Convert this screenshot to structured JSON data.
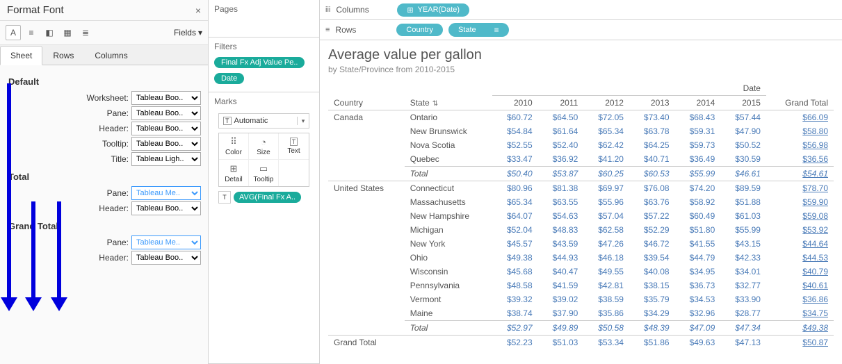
{
  "format_panel": {
    "title": "Format Font",
    "fields_label": "Fields",
    "tabs": [
      "Sheet",
      "Rows",
      "Columns"
    ],
    "sections": {
      "default": {
        "title": "Default",
        "rows": [
          {
            "label": "Worksheet:",
            "value": "Tableau Boo..",
            "blue": false
          },
          {
            "label": "Pane:",
            "value": "Tableau Boo..",
            "blue": false
          },
          {
            "label": "Header:",
            "value": "Tableau Boo..",
            "blue": false
          },
          {
            "label": "Tooltip:",
            "value": "Tableau Boo..",
            "blue": false
          },
          {
            "label": "Title:",
            "value": "Tableau Ligh..",
            "blue": false
          }
        ]
      },
      "total": {
        "title": "Total",
        "rows": [
          {
            "label": "Pane:",
            "value": "Tableau Me..",
            "blue": true
          },
          {
            "label": "Header:",
            "value": "Tableau Boo..",
            "blue": false
          }
        ]
      },
      "grand_total": {
        "title": "Grand Total",
        "rows": [
          {
            "label": "Pane:",
            "value": "Tableau Me..",
            "blue": true
          },
          {
            "label": "Header:",
            "value": "Tableau Boo..",
            "blue": false
          }
        ]
      }
    }
  },
  "shelves": {
    "pages": "Pages",
    "filters": "Filters",
    "filter_pills": [
      "Final Fx Adj Value Pe..",
      "Date"
    ],
    "marks": "Marks",
    "marks_type": "Automatic",
    "mark_cells": [
      "Color",
      "Size",
      "Text",
      "Detail",
      "Tooltip"
    ],
    "mark_pill": "AVG(Final Fx A..",
    "columns_label": "Columns",
    "columns_pill": "YEAR(Date)",
    "rows_label": "Rows",
    "rows_pills": [
      "Country",
      "State"
    ]
  },
  "viz": {
    "title": "Average value per gallon",
    "subtitle": "by State/Province from 2010-2015",
    "date_label": "Date",
    "col_country": "Country",
    "col_state": "State",
    "years": [
      "2010",
      "2011",
      "2012",
      "2013",
      "2014",
      "2015"
    ],
    "grand_total_label": "Grand Total",
    "total_label": "Total",
    "groups": [
      {
        "country": "Canada",
        "rows": [
          {
            "state": "Ontario",
            "v": [
              "$60.72",
              "$64.50",
              "$72.05",
              "$73.40",
              "$68.43",
              "$57.44"
            ],
            "gt": "$66.09"
          },
          {
            "state": "New Brunswick",
            "v": [
              "$54.84",
              "$61.64",
              "$65.34",
              "$63.78",
              "$59.31",
              "$47.90"
            ],
            "gt": "$58.80"
          },
          {
            "state": "Nova Scotia",
            "v": [
              "$52.55",
              "$52.40",
              "$62.42",
              "$64.25",
              "$59.73",
              "$50.52"
            ],
            "gt": "$56.98"
          },
          {
            "state": "Quebec",
            "v": [
              "$33.47",
              "$36.92",
              "$41.20",
              "$40.71",
              "$36.49",
              "$30.59"
            ],
            "gt": "$36.56"
          }
        ],
        "total": {
          "v": [
            "$50.40",
            "$53.87",
            "$60.25",
            "$60.53",
            "$55.99",
            "$46.61"
          ],
          "gt": "$54.61"
        }
      },
      {
        "country": "United States",
        "rows": [
          {
            "state": "Connecticut",
            "v": [
              "$80.96",
              "$81.38",
              "$69.97",
              "$76.08",
              "$74.20",
              "$89.59"
            ],
            "gt": "$78.70"
          },
          {
            "state": "Massachusetts",
            "v": [
              "$65.34",
              "$63.55",
              "$55.96",
              "$63.76",
              "$58.92",
              "$51.88"
            ],
            "gt": "$59.90"
          },
          {
            "state": "New Hampshire",
            "v": [
              "$64.07",
              "$54.63",
              "$57.04",
              "$57.22",
              "$60.49",
              "$61.03"
            ],
            "gt": "$59.08"
          },
          {
            "state": "Michigan",
            "v": [
              "$52.04",
              "$48.83",
              "$62.58",
              "$52.29",
              "$51.80",
              "$55.99"
            ],
            "gt": "$53.92"
          },
          {
            "state": "New York",
            "v": [
              "$45.57",
              "$43.59",
              "$47.26",
              "$46.72",
              "$41.55",
              "$43.15"
            ],
            "gt": "$44.64"
          },
          {
            "state": "Ohio",
            "v": [
              "$49.38",
              "$44.93",
              "$46.18",
              "$39.54",
              "$44.79",
              "$42.33"
            ],
            "gt": "$44.53"
          },
          {
            "state": "Wisconsin",
            "v": [
              "$45.68",
              "$40.47",
              "$49.55",
              "$40.08",
              "$34.95",
              "$34.01"
            ],
            "gt": "$40.79"
          },
          {
            "state": "Pennsylvania",
            "v": [
              "$48.58",
              "$41.59",
              "$42.81",
              "$38.15",
              "$36.73",
              "$32.77"
            ],
            "gt": "$40.61"
          },
          {
            "state": "Vermont",
            "v": [
              "$39.32",
              "$39.02",
              "$38.59",
              "$35.79",
              "$34.53",
              "$33.90"
            ],
            "gt": "$36.86"
          },
          {
            "state": "Maine",
            "v": [
              "$38.74",
              "$37.90",
              "$35.86",
              "$34.29",
              "$32.96",
              "$28.77"
            ],
            "gt": "$34.75"
          }
        ],
        "total": {
          "v": [
            "$52.97",
            "$49.89",
            "$50.58",
            "$48.39",
            "$47.09",
            "$47.34"
          ],
          "gt": "$49.38"
        }
      }
    ],
    "grand": {
      "v": [
        "$52.23",
        "$51.03",
        "$53.34",
        "$51.86",
        "$49.63",
        "$47.13"
      ],
      "gt": "$50.87"
    }
  }
}
